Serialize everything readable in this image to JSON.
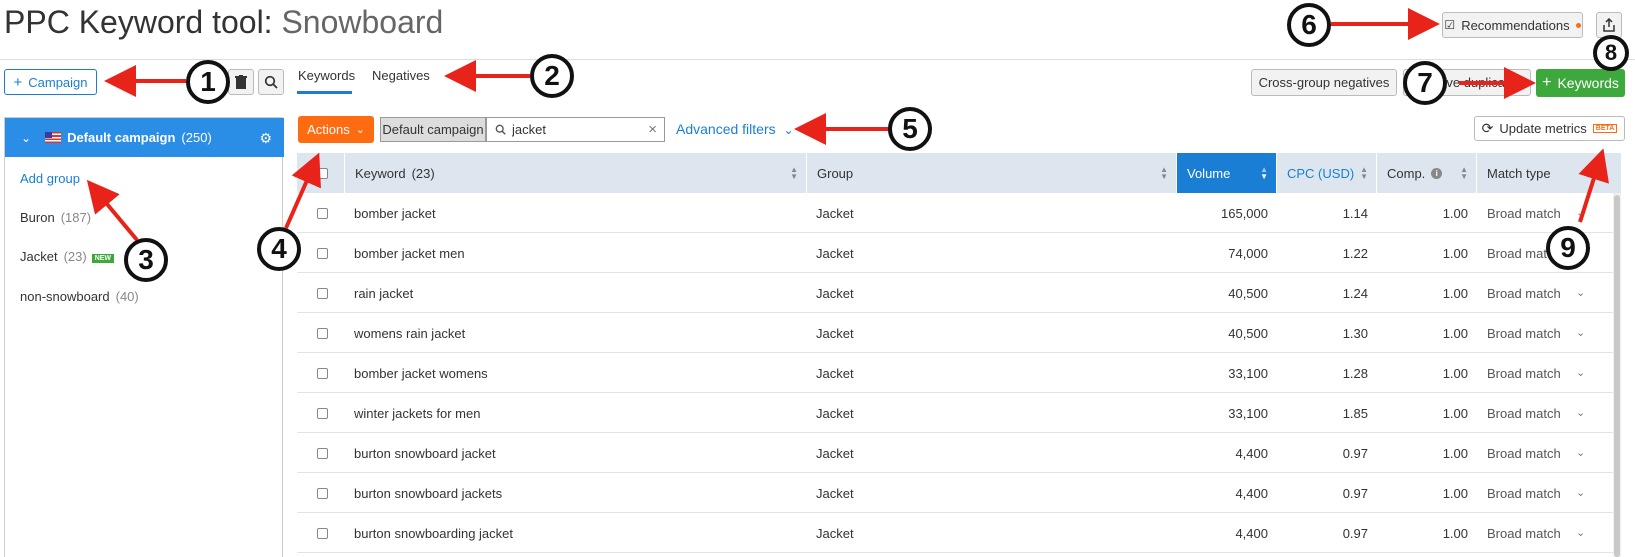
{
  "header": {
    "title": "PPC Keyword tool:",
    "project": "Snowboard",
    "recommendations_label": "Recommendations",
    "accent_color": "#ff6b10"
  },
  "toolbar": {
    "campaign_button": "Campaign",
    "tabs": [
      {
        "label": "Keywords",
        "active": true
      },
      {
        "label": "Negatives",
        "active": false
      }
    ],
    "cross_group_negatives": "Cross-group negatives",
    "remove_duplicates": "Remove duplicates",
    "add_keywords": "Keywords",
    "actions": "Actions",
    "default_campaign_chip": "Default campaign",
    "search_value": "jacket",
    "advanced_filters": "Advanced filters",
    "update_metrics": "Update metrics",
    "beta_badge": "BETA"
  },
  "sidebar": {
    "campaign_name": "Default campaign",
    "campaign_count": "(250)",
    "add_group": "Add group",
    "groups": [
      {
        "name": "Buron",
        "count": "(187)",
        "is_new": false
      },
      {
        "name": "Jacket",
        "count": "(23)",
        "is_new": true
      },
      {
        "name": "non-snowboard",
        "count": "(40)",
        "is_new": false
      }
    ],
    "new_badge": "NEW"
  },
  "table": {
    "columns": {
      "keyword": "Keyword",
      "keyword_count": "(23)",
      "group": "Group",
      "volume": "Volume",
      "cpc": "CPC (USD)",
      "comp": "Comp.",
      "match_type": "Match type"
    },
    "rows": [
      {
        "keyword": "bomber jacket",
        "group": "Jacket",
        "volume": "165,000",
        "cpc": "1.14",
        "comp": "1.00",
        "match": "Broad match"
      },
      {
        "keyword": "bomber jacket men",
        "group": "Jacket",
        "volume": "74,000",
        "cpc": "1.22",
        "comp": "1.00",
        "match": "Broad match"
      },
      {
        "keyword": "rain jacket",
        "group": "Jacket",
        "volume": "40,500",
        "cpc": "1.24",
        "comp": "1.00",
        "match": "Broad match"
      },
      {
        "keyword": "womens rain jacket",
        "group": "Jacket",
        "volume": "40,500",
        "cpc": "1.30",
        "comp": "1.00",
        "match": "Broad match"
      },
      {
        "keyword": "bomber jacket womens",
        "group": "Jacket",
        "volume": "33,100",
        "cpc": "1.28",
        "comp": "1.00",
        "match": "Broad match"
      },
      {
        "keyword": "winter jackets for men",
        "group": "Jacket",
        "volume": "33,100",
        "cpc": "1.85",
        "comp": "1.00",
        "match": "Broad match"
      },
      {
        "keyword": "burton snowboard jacket",
        "group": "Jacket",
        "volume": "4,400",
        "cpc": "0.97",
        "comp": "1.00",
        "match": "Broad match"
      },
      {
        "keyword": "burton snowboard jackets",
        "group": "Jacket",
        "volume": "4,400",
        "cpc": "0.97",
        "comp": "1.00",
        "match": "Broad match"
      },
      {
        "keyword": "burton snowboarding jacket",
        "group": "Jacket",
        "volume": "4,400",
        "cpc": "0.97",
        "comp": "1.00",
        "match": "Broad match"
      }
    ]
  },
  "callouts": [
    "1",
    "2",
    "3",
    "4",
    "5",
    "6",
    "7",
    "8",
    "9"
  ],
  "colors": {
    "brand_blue": "#1a7fd4",
    "green": "#3da93d",
    "orange": "#ff6b10",
    "callout_arrow": "#e8231a"
  }
}
